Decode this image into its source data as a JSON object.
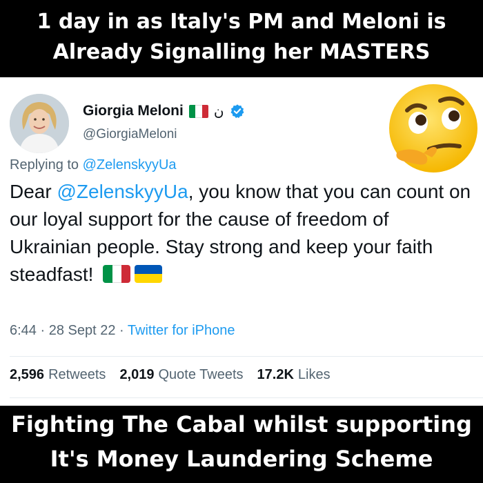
{
  "caption_top": {
    "line1": "1 day in as Italy's PM and Meloni is",
    "line2": "Already Signalling her MASTERS"
  },
  "caption_bottom": {
    "line1": "Fighting The Cabal whilst supporting",
    "line2": "It's Money Laundering Scheme"
  },
  "tweet": {
    "author": {
      "display_name": "Giorgia Meloni",
      "name_symbol": "ن",
      "handle": "@GiorgiaMeloni"
    },
    "replying_prefix": "Replying to ",
    "replying_to": "@ZelenskyyUa",
    "text": {
      "greeting": "Dear ",
      "mention": "@ZelenskyyUa",
      "body": ", you know that you can count on our loyal support for the cause of freedom of Ukrainian people. Stay strong and keep your faith steadfast!"
    },
    "meta": {
      "time": "6:44",
      "separator": " · ",
      "date": "28 Sept 22",
      "source": "Twitter for iPhone"
    },
    "stats": {
      "retweets_count": "2,596",
      "retweets_label": "Retweets",
      "quotes_count": "2,019",
      "quotes_label": "Quote Tweets",
      "likes_count": "17.2K",
      "likes_label": "Likes"
    }
  },
  "icons": {
    "emoji": "thinking-face-icon",
    "verified": "verified-badge-icon",
    "flag_italy": "italy-flag-icon",
    "flag_ukraine": "ukraine-flag-icon"
  },
  "colors": {
    "banner_bg": "#000000",
    "banner_text": "#ffffff",
    "link_blue": "#1d9bf0",
    "secondary_text": "#536471",
    "italy_green": "#009246",
    "italy_white": "#ffffff",
    "italy_red": "#ce2b37",
    "ukraine_blue": "#0057b7",
    "ukraine_yellow": "#ffd700"
  }
}
